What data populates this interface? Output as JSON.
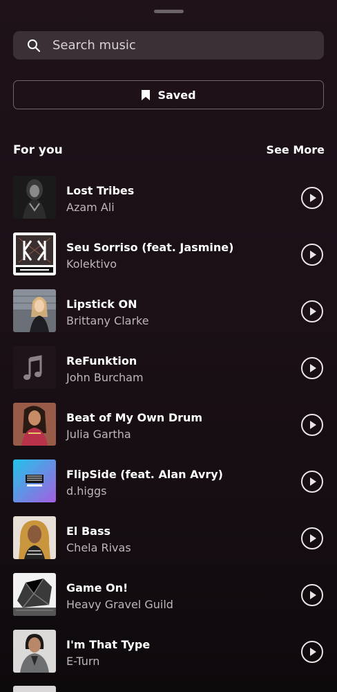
{
  "search": {
    "placeholder": "Search music"
  },
  "saved": {
    "label": "Saved"
  },
  "section": {
    "title": "For you",
    "see_more": "See More"
  },
  "tracks": [
    {
      "title": "Lost Tribes",
      "artist": "Azam Ali",
      "art": "portrait-photo"
    },
    {
      "title": "Seu Sorriso (feat. Jasmine)",
      "artist": "Kolektivo",
      "art": "kolektivo-logo"
    },
    {
      "title": "Lipstick ON",
      "artist": "Brittany Clarke",
      "art": "portrait-photo"
    },
    {
      "title": "ReFunktion",
      "artist": "John Burcham",
      "art": "music-note-icon"
    },
    {
      "title": "Beat of My Own Drum",
      "artist": "Julia Gartha",
      "art": "portrait-photo"
    },
    {
      "title": "FlipSide (feat. Alan Avry)",
      "artist": "d.higgs",
      "art": "gradient-cover"
    },
    {
      "title": "El Bass",
      "artist": "Chela Rivas",
      "art": "portrait-photo"
    },
    {
      "title": "Game On!",
      "artist": "Heavy Gravel Guild",
      "art": "bw-photo"
    },
    {
      "title": "I'm That Type",
      "artist": "E-Turn",
      "art": "portrait-photo"
    }
  ],
  "colors": {
    "background": "#1c1117",
    "search_bg": "#3a3036",
    "text_secondary": "#bdb6ba"
  }
}
